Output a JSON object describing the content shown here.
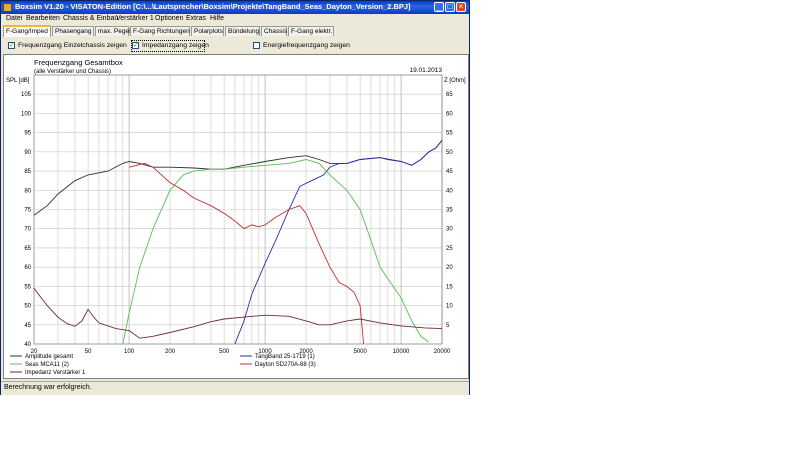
{
  "window": {
    "title": "Boxsim V1.20 - VISATON-Edition [C:\\...\\Lautsprecher\\Boxsim\\Projekte\\TangBand_Seas_Dayton_Version_2.BPJ]",
    "minimize": "_",
    "maximize": "□",
    "close": "×"
  },
  "menu": [
    "Datei",
    "Bearbeiten",
    "Chassis & Einbau",
    "Verstärker 1",
    "Optionen",
    "Extras",
    "Hilfe"
  ],
  "tabs": [
    "F-Gang/Imped",
    "Phasengang",
    "max. Pegel",
    "F-Gang Richtungen",
    "Polarplots",
    "Bündelung",
    "Chassis",
    "F-Gang elektr."
  ],
  "checkboxes": [
    {
      "label": "Frequenzgang Einzelchassis zeigen",
      "checked": true
    },
    {
      "label": "Impedanzgang zeigen",
      "checked": true
    },
    {
      "label": "Energiefrequenzgang zeigen",
      "checked": false
    }
  ],
  "status": "Berechnung war erfolgreich.",
  "chart_data": {
    "type": "line",
    "title": "Frequenzgang Gesamtbox",
    "subtitle": "(alle Verstärker und Chassis)",
    "date": "19.01.2013",
    "ylabel": "SPL [dB]",
    "y2label": "Z [Ohm]",
    "x_scale": "log",
    "xlim": [
      20,
      20000
    ],
    "ylim": [
      40,
      110
    ],
    "y2lim": [
      0,
      70
    ],
    "x_ticks": [
      20,
      50,
      100,
      200,
      500,
      1000,
      2000,
      5000,
      10000,
      20000
    ],
    "y_ticks": [
      40,
      45,
      50,
      55,
      60,
      65,
      70,
      75,
      80,
      85,
      90,
      95,
      100,
      105
    ],
    "y2_ticks": [
      5,
      10,
      15,
      20,
      25,
      30,
      35,
      40,
      45,
      50,
      55,
      60,
      65
    ],
    "grid": true,
    "legend_position": "bottom",
    "series": [
      {
        "name": "Amplitude gesamt",
        "axis": "left",
        "color": "#303030",
        "points": [
          [
            20,
            73.5
          ],
          [
            25,
            76
          ],
          [
            30,
            79
          ],
          [
            40,
            82.5
          ],
          [
            50,
            84
          ],
          [
            70,
            85
          ],
          [
            90,
            87
          ],
          [
            100,
            87.5
          ],
          [
            120,
            87
          ],
          [
            150,
            86
          ],
          [
            200,
            86
          ],
          [
            300,
            85.8
          ],
          [
            400,
            85.5
          ],
          [
            500,
            85.5
          ],
          [
            700,
            86.5
          ],
          [
            1000,
            87.5
          ],
          [
            1500,
            88.5
          ],
          [
            2000,
            89
          ],
          [
            2500,
            88
          ],
          [
            3000,
            87
          ],
          [
            4000,
            87
          ],
          [
            5000,
            88
          ],
          [
            7000,
            88.5
          ],
          [
            8000,
            88
          ],
          [
            10000,
            87.5
          ],
          [
            12000,
            86.5
          ],
          [
            14000,
            88
          ],
          [
            16000,
            90
          ],
          [
            18000,
            91
          ],
          [
            20000,
            93
          ]
        ]
      },
      {
        "name": "TangBand 25-1719 (1)",
        "axis": "left",
        "color": "#2a2ab0",
        "points": [
          [
            600,
            40
          ],
          [
            700,
            46
          ],
          [
            800,
            53
          ],
          [
            1000,
            61
          ],
          [
            1200,
            67
          ],
          [
            1500,
            75
          ],
          [
            1800,
            81
          ],
          [
            2200,
            82.5
          ],
          [
            2700,
            84
          ],
          [
            3000,
            86
          ],
          [
            3500,
            87
          ],
          [
            4000,
            87
          ],
          [
            5000,
            88
          ],
          [
            7000,
            88.5
          ],
          [
            10000,
            87.5
          ],
          [
            12000,
            86.5
          ],
          [
            14000,
            88
          ],
          [
            16000,
            90
          ],
          [
            18000,
            91
          ],
          [
            20000,
            93
          ]
        ]
      },
      {
        "name": "Seas MCA11 (2)",
        "axis": "left",
        "color": "#55c055",
        "points": [
          [
            90,
            40
          ],
          [
            100,
            48
          ],
          [
            120,
            60
          ],
          [
            150,
            70
          ],
          [
            200,
            80
          ],
          [
            250,
            84
          ],
          [
            300,
            85
          ],
          [
            400,
            85.5
          ],
          [
            500,
            85.5
          ],
          [
            700,
            86
          ],
          [
            1000,
            86.5
          ],
          [
            1500,
            87
          ],
          [
            2000,
            88
          ],
          [
            2500,
            87
          ],
          [
            3000,
            84
          ],
          [
            4000,
            80
          ],
          [
            5000,
            75
          ],
          [
            6000,
            67
          ],
          [
            7000,
            60
          ],
          [
            8000,
            57
          ],
          [
            10000,
            52
          ],
          [
            12000,
            46
          ],
          [
            14000,
            42
          ],
          [
            16000,
            40.5
          ]
        ]
      },
      {
        "name": "Dayton SD270A-88 (3)",
        "axis": "left",
        "color": "#c03030",
        "points": [
          [
            100,
            86
          ],
          [
            130,
            87
          ],
          [
            150,
            86
          ],
          [
            200,
            82
          ],
          [
            250,
            80
          ],
          [
            300,
            78
          ],
          [
            400,
            76
          ],
          [
            500,
            74
          ],
          [
            600,
            72
          ],
          [
            700,
            70
          ],
          [
            800,
            71
          ],
          [
            900,
            70.5
          ],
          [
            1000,
            71
          ],
          [
            1200,
            73
          ],
          [
            1500,
            75
          ],
          [
            1800,
            76
          ],
          [
            2000,
            74
          ],
          [
            2500,
            66
          ],
          [
            3000,
            60
          ],
          [
            3500,
            56
          ],
          [
            4000,
            55
          ],
          [
            4500,
            53.5
          ],
          [
            5000,
            50
          ],
          [
            5300,
            40
          ]
        ]
      },
      {
        "name": "Impedanz Verstärker 1",
        "axis": "right",
        "color": "#6e2a3a",
        "points": [
          [
            20,
            14.5
          ],
          [
            25,
            10
          ],
          [
            30,
            7
          ],
          [
            35,
            5.3
          ],
          [
            40,
            4.6
          ],
          [
            45,
            6
          ],
          [
            50,
            9
          ],
          [
            55,
            7
          ],
          [
            60,
            5.5
          ],
          [
            80,
            4
          ],
          [
            100,
            3.5
          ],
          [
            120,
            1.5
          ],
          [
            150,
            2
          ],
          [
            200,
            3
          ],
          [
            300,
            4.5
          ],
          [
            400,
            5.8
          ],
          [
            500,
            6.5
          ],
          [
            700,
            7
          ],
          [
            1000,
            7.5
          ],
          [
            1500,
            7.2
          ],
          [
            2000,
            6
          ],
          [
            2500,
            5
          ],
          [
            3000,
            5
          ],
          [
            4000,
            6
          ],
          [
            5000,
            6.5
          ],
          [
            7000,
            5.5
          ],
          [
            10000,
            4.7
          ],
          [
            15000,
            4.2
          ],
          [
            20000,
            4
          ]
        ]
      }
    ]
  }
}
